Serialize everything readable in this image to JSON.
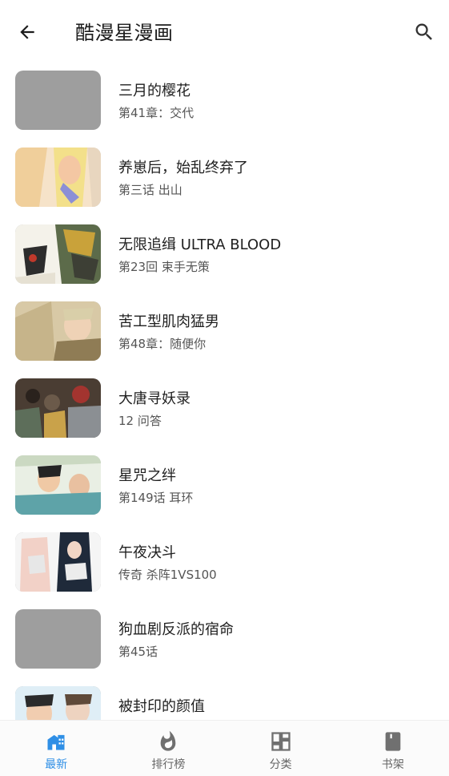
{
  "header": {
    "title": "酷漫星漫画",
    "back_icon": "arrow-left-icon",
    "search_icon": "search-icon"
  },
  "comics": [
    {
      "title": "三月的樱花",
      "subtitle": "第41章：交代",
      "cover": "placeholder"
    },
    {
      "title": "养崽后，始乱终弃了",
      "subtitle": "第三话 出山",
      "cover": "image"
    },
    {
      "title": "无限追缉 ULTRA BLOOD",
      "subtitle": "第23回 束手无策",
      "cover": "image"
    },
    {
      "title": "苦工型肌肉猛男",
      "subtitle": "第48章：随便你",
      "cover": "image"
    },
    {
      "title": "大唐寻妖录",
      "subtitle": "12 问答",
      "cover": "image"
    },
    {
      "title": "星咒之绊",
      "subtitle": "第149话 耳环",
      "cover": "image"
    },
    {
      "title": "午夜决斗",
      "subtitle": "传奇 杀阵1VS100",
      "cover": "image"
    },
    {
      "title": "狗血剧反派的宿命",
      "subtitle": "第45话",
      "cover": "placeholder"
    },
    {
      "title": "被封印的颜值",
      "subtitle": "",
      "cover": "image"
    }
  ],
  "bottom_nav": [
    {
      "label": "最新",
      "icon": "home-icon",
      "active": true
    },
    {
      "label": "排行榜",
      "icon": "flame-icon",
      "active": false
    },
    {
      "label": "分类",
      "icon": "grid-icon",
      "active": false
    },
    {
      "label": "书架",
      "icon": "book-icon",
      "active": false
    }
  ],
  "colors": {
    "accent": "#2f8fe6",
    "placeholder": "#9e9e9e",
    "nav_inactive": "#666666"
  }
}
